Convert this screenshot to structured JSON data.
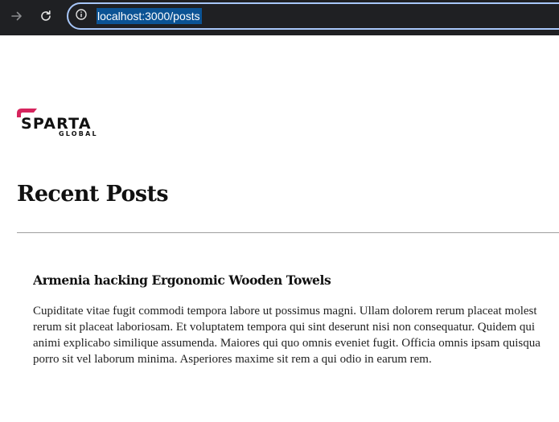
{
  "browser": {
    "url": "localhost:3000/posts",
    "forward_icon": "arrow-right-icon",
    "reload_icon": "reload-icon",
    "site_info_icon": "info-circle-icon",
    "selection_color": "#0b5394",
    "accent": "#a8c7fa"
  },
  "page": {
    "logo": {
      "brand": "SPARTA",
      "sub": "GLOBAL",
      "accent_color": "#d6245d"
    },
    "title": "Recent Posts",
    "posts": [
      {
        "title": "Armenia hacking Ergonomic Wooden Towels",
        "body_lines": [
          "Cupiditate vitae fugit commodi tempora labore ut possimus magni. Ullam dolorem rerum placeat molest",
          "rerum sit placeat laboriosam. Et voluptatem tempora qui sint deserunt nisi non consequatur. Quidem qui",
          "animi explicabo similique assumenda. Maiores qui quo omnis eveniet fugit. Officia omnis ipsam quisqua",
          "porro sit vel laborum minima. Asperiores maxime sit rem a qui odio in earum rem."
        ]
      }
    ]
  }
}
